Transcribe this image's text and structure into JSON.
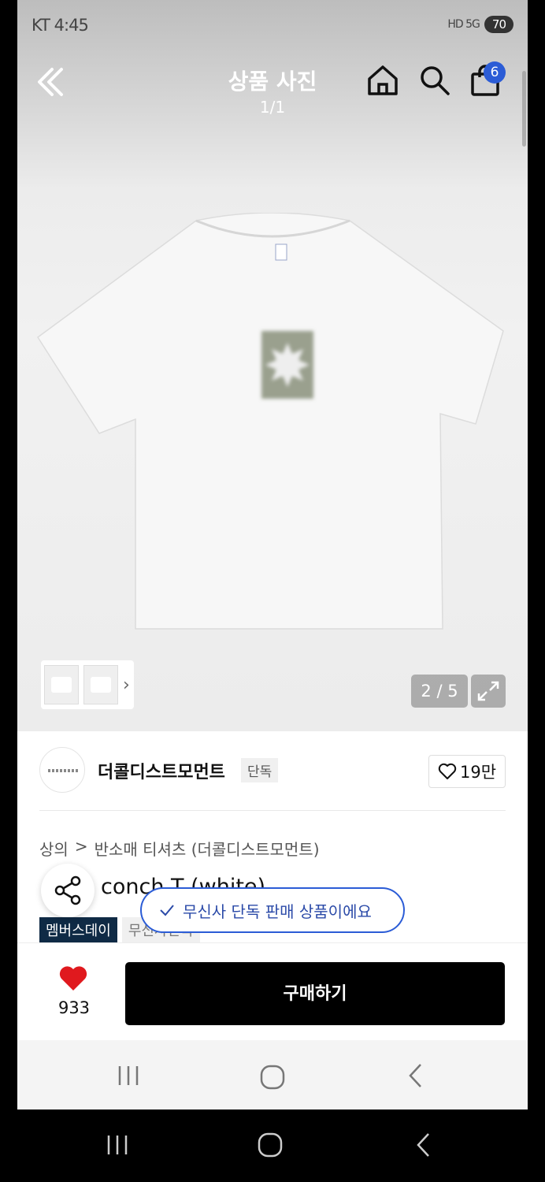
{
  "status_bar": {
    "time": "KT 4:45",
    "signal": "HD 5G",
    "battery": "70"
  },
  "header": {
    "title": "상품 사진",
    "page": "1/1",
    "cart_count": "6"
  },
  "gallery": {
    "counter": "2 / 5"
  },
  "brand": {
    "name": "더콜디스트모먼트",
    "badge": "단독",
    "likes": "19만"
  },
  "breadcrumb": {
    "category": "상의",
    "separator": ">",
    "sub": "반소매 티셔츠 (더콜디스트모먼트)"
  },
  "product": {
    "title": "conch T (white)"
  },
  "tags": {
    "member": "멤버스데이",
    "muted": "무신사단독"
  },
  "toast": {
    "text": "무신사 단독 판매 상품이에요"
  },
  "bottom": {
    "fav_count": "933",
    "buy_label": "구매하기"
  },
  "icons": [
    "back-icon",
    "home-icon",
    "search-icon",
    "bag-icon",
    "expand-icon",
    "heart-outline-icon",
    "share-icon",
    "check-icon",
    "heart-filled-icon",
    "recents-icon",
    "home-circle-icon",
    "back-arrow-icon"
  ],
  "colors": {
    "accent": "#2b5cd6",
    "buy": "#000000",
    "heart": "#e0191e",
    "member_tag": "#0f2a45"
  }
}
